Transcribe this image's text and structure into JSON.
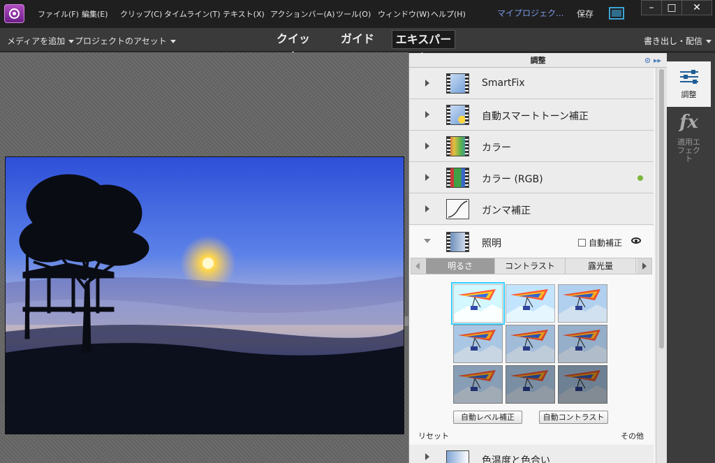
{
  "menubar": {
    "items": [
      "ファイル(F)",
      "編集(E)",
      "クリップ(C)",
      "タイムライン(T)",
      "テキスト(X)",
      "アクションバー(A)",
      "ツール(O)",
      "ウィンドウ(W)",
      "ヘルプ(H)"
    ],
    "project_name": "マイプロジェク...",
    "save": "保存",
    "window_controls": [
      "–",
      "□",
      "✕"
    ]
  },
  "modebar": {
    "add_media": "メディアを追加",
    "project_assets": "プロジェクトのアセット",
    "tabs": [
      "クイック",
      "ガイド",
      "エキスパート"
    ],
    "active_tab": "エキスパート",
    "export": "書き出し・配信"
  },
  "panel": {
    "title": "調整",
    "header_icons": "⊙ ▸▸",
    "rows": [
      {
        "label": "SmartFix",
        "icon": "smartfix-icon"
      },
      {
        "label": "自動スマートトーン補正",
        "icon": "auto-smart-tone-icon"
      },
      {
        "label": "カラー",
        "icon": "color-icon"
      },
      {
        "label": "カラー (RGB)",
        "icon": "color-rgb-icon",
        "active": true
      },
      {
        "label": "ガンマ補正",
        "icon": "gamma-icon"
      }
    ],
    "lighting": {
      "label": "照明",
      "auto_fix": "自動補正",
      "subtabs": [
        "明るさ",
        "コントラスト",
        "露光量"
      ],
      "active_subtab": "明るさ",
      "auto_levels": "自動レベル補正",
      "auto_contrast": "自動コントラスト",
      "reset": "リセット",
      "other": "その他"
    },
    "next_row": "色温度と色合い"
  },
  "sidebar": {
    "adjust": "調整",
    "effects": "適用エフェクト",
    "effects_icon": "fx"
  },
  "colors": {
    "accent_blue": "#2aa6e0",
    "project_name": "#7b9ae6",
    "status_green": "#7ab63e"
  }
}
